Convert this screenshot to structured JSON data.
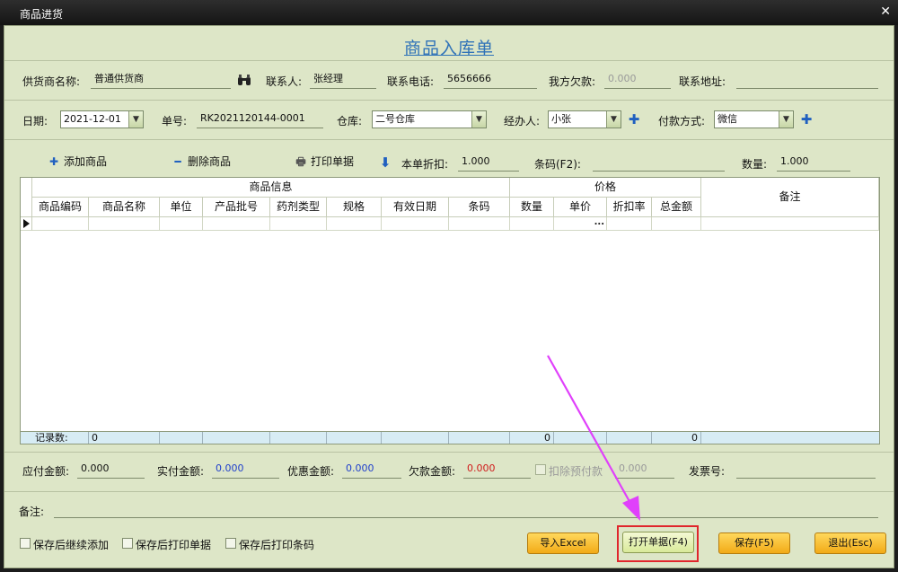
{
  "window": {
    "title": "商品进货",
    "close_glyph": "✕"
  },
  "doc_title": "商品入库单",
  "supplier": {
    "label": "供货商名称:",
    "value": "普通供货商",
    "icon": "binoculars-icon"
  },
  "contact": {
    "label": "联系人:",
    "value": "张经理"
  },
  "phone": {
    "label": "联系电话:",
    "value": "5656666"
  },
  "debt": {
    "label": "我方欠款:",
    "value": "0.000"
  },
  "address": {
    "label": "联系地址:",
    "value": ""
  },
  "date": {
    "label": "日期:",
    "value": "2021-12-01"
  },
  "order_no": {
    "label": "单号:",
    "value": "RK2021120144-0001"
  },
  "warehouse": {
    "label": "仓库:",
    "value": "二号仓库"
  },
  "handler": {
    "label": "经办人:",
    "value": "小张"
  },
  "payment": {
    "label": "付款方式:",
    "value": "微信"
  },
  "toolbar": {
    "add_label": "添加商品",
    "delete_label": "删除商品",
    "print_label": "打印单据",
    "discount_label": "本单折扣:",
    "discount_value": "1.000",
    "barcode_label": "条码(F2):",
    "barcode_value": "",
    "qty_label": "数量:",
    "qty_value": "1.000"
  },
  "grid": {
    "group_product": "商品信息",
    "group_price": "价格",
    "remark_header": "备注",
    "columns": [
      "商品编码",
      "商品名称",
      "单位",
      "产品批号",
      "药剂类型",
      "规格",
      "有效日期",
      "条码",
      "数量",
      "单价",
      "折扣率",
      "总金额"
    ],
    "ellipsis": "...",
    "footer": {
      "label": "记录数:",
      "count": "0",
      "qty_total": "0",
      "amount_total": "0"
    }
  },
  "summary": {
    "payable_label": "应付金额:",
    "payable_value": "0.000",
    "paid_label": "实付金额:",
    "paid_value": "0.000",
    "discount_label": "优惠金额:",
    "discount_value": "0.000",
    "owed_label": "欠款金额:",
    "owed_value": "0.000",
    "deduct_label": "扣除预付款",
    "deduct_value": "0.000",
    "invoice_label": "发票号:",
    "invoice_value": ""
  },
  "remark": {
    "label": "备注:",
    "value": ""
  },
  "options": {
    "continue_add": "保存后继续添加",
    "print_doc": "保存后打印单据",
    "print_barcode": "保存后打印条码"
  },
  "buttons": {
    "import_excel": "导入Excel",
    "open_doc": "打开单据(F4)",
    "save": "保存(F5)",
    "exit": "退出(Esc)"
  },
  "colors": {
    "accent": "#2f72b8",
    "highlight": "#e0262c",
    "arrow": "#e040fb"
  }
}
